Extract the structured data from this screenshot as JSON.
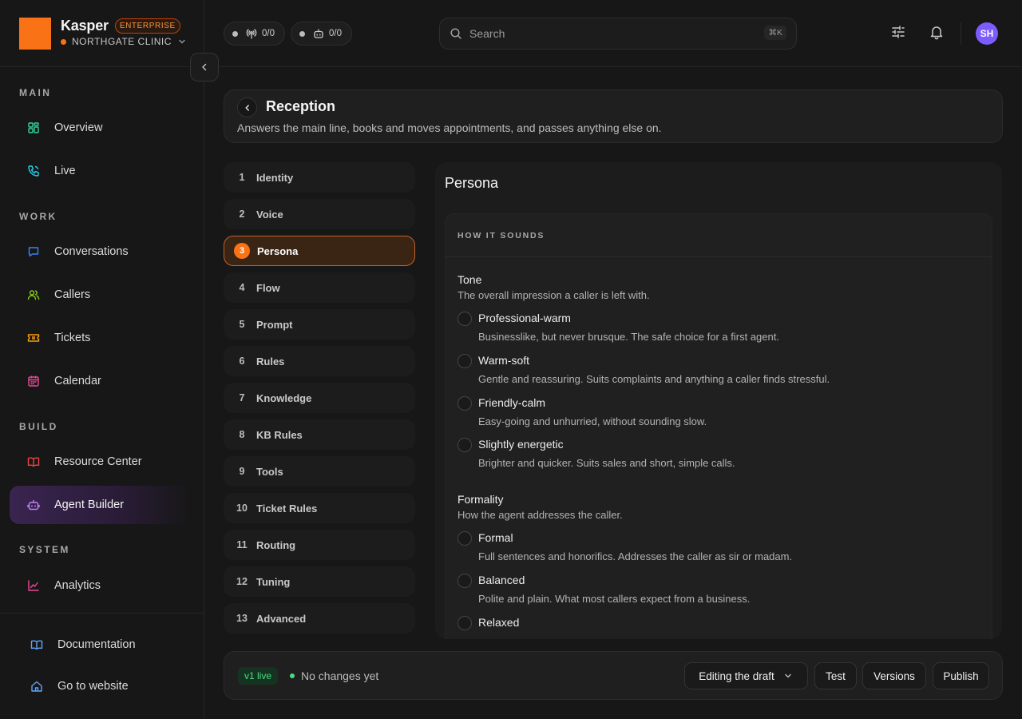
{
  "brand": {
    "name": "Kasper",
    "badge": "ENTERPRISE",
    "org": "NORTHGATE CLINIC",
    "accent": "#f97316"
  },
  "sidebar": {
    "sections": {
      "main": "MAIN",
      "work": "WORK",
      "build": "BUILD",
      "system": "SYSTEM"
    },
    "items": [
      {
        "label": "Overview",
        "icon": "grid-icon"
      },
      {
        "label": "Live",
        "icon": "phone-icon"
      },
      {
        "label": "Conversations",
        "icon": "chat-icon"
      },
      {
        "label": "Callers",
        "icon": "users-icon"
      },
      {
        "label": "Tickets",
        "icon": "ticket-icon"
      },
      {
        "label": "Calendar",
        "icon": "calendar-icon"
      },
      {
        "label": "Resource Center",
        "icon": "book-open-icon"
      },
      {
        "label": "Agent Builder",
        "icon": "bot-icon",
        "active": true
      },
      {
        "label": "Analytics",
        "icon": "chart-line-icon"
      }
    ],
    "footer": [
      {
        "label": "Documentation",
        "icon": "book-icon"
      },
      {
        "label": "Go to website",
        "icon": "home-icon"
      }
    ]
  },
  "topbar": {
    "calls_counter": "0/0",
    "agents_counter": "0/0",
    "search_placeholder": "Search",
    "search_shortcut": "⌘K",
    "avatar_initials": "SH"
  },
  "page": {
    "title": "Reception",
    "description": "Answers the main line, books and moves appointments, and passes anything else on."
  },
  "steps": [
    {
      "num": "1",
      "label": "Identity"
    },
    {
      "num": "2",
      "label": "Voice"
    },
    {
      "num": "3",
      "label": "Persona",
      "active": true
    },
    {
      "num": "4",
      "label": "Flow"
    },
    {
      "num": "5",
      "label": "Prompt"
    },
    {
      "num": "6",
      "label": "Rules"
    },
    {
      "num": "7",
      "label": "Knowledge"
    },
    {
      "num": "8",
      "label": "KB Rules"
    },
    {
      "num": "9",
      "label": "Tools"
    },
    {
      "num": "10",
      "label": "Ticket Rules"
    },
    {
      "num": "11",
      "label": "Routing"
    },
    {
      "num": "12",
      "label": "Tuning"
    },
    {
      "num": "13",
      "label": "Advanced"
    }
  ],
  "persona": {
    "title": "Persona",
    "section_title": "HOW IT SOUNDS",
    "tone": {
      "label": "Tone",
      "help": "The overall impression a caller is left with.",
      "options": [
        {
          "label": "Professional-warm",
          "desc": "Businesslike, but never brusque. The safe choice for a first agent."
        },
        {
          "label": "Warm-soft",
          "desc": "Gentle and reassuring. Suits complaints and anything a caller finds stressful."
        },
        {
          "label": "Friendly-calm",
          "desc": "Easy-going and unhurried, without sounding slow."
        },
        {
          "label": "Slightly energetic",
          "desc": "Brighter and quicker. Suits sales and short, simple calls."
        }
      ]
    },
    "formality": {
      "label": "Formality",
      "help": "How the agent addresses the caller.",
      "options": [
        {
          "label": "Formal",
          "desc": "Full sentences and honorifics. Addresses the caller as sir or madam."
        },
        {
          "label": "Balanced",
          "desc": "Polite and plain. What most callers expect from a business."
        },
        {
          "label": "Relaxed",
          "desc": ""
        }
      ]
    }
  },
  "bottom": {
    "version_badge": "v1 live",
    "status": "No changes yet",
    "mode_select": "Editing the draft",
    "test": "Test",
    "versions": "Versions",
    "publish": "Publish"
  }
}
